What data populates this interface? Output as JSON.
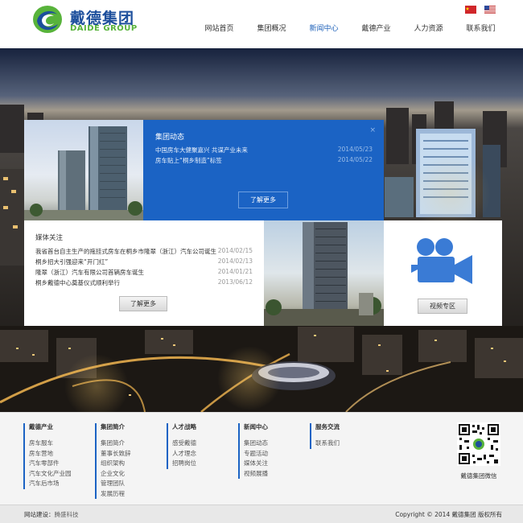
{
  "brand": {
    "name_cn": "戴德集团",
    "name_en": "DAIDE GROUP",
    "colors": {
      "blue": "#1b63c4",
      "green": "#58b33b",
      "dark_blue": "#1d4f9c"
    }
  },
  "nav": {
    "items": [
      {
        "label": "网站首页",
        "active": false
      },
      {
        "label": "集团概况",
        "active": false
      },
      {
        "label": "新闻中心",
        "active": true
      },
      {
        "label": "戴德产业",
        "active": false
      },
      {
        "label": "人力资源",
        "active": false
      },
      {
        "label": "联系我们",
        "active": false
      }
    ]
  },
  "languages": [
    {
      "icon": "china-flag-icon"
    },
    {
      "icon": "usa-flag-icon"
    }
  ],
  "news_panel": {
    "title": "集团动态",
    "close": "×",
    "items": [
      {
        "title": "中国房车大健聚嘉兴 共谋产业未来",
        "date": "2014/05/23"
      },
      {
        "title": "房车贴上“桐乡制造”标签",
        "date": "2014/05/22"
      }
    ],
    "more": "了解更多"
  },
  "media_panel": {
    "title": "媒体关注",
    "items": [
      {
        "title": "我省首台自主生产的拖挂式房车在桐乡市隆翠（浙江）汽车公司诞生",
        "date": "2014/02/15"
      },
      {
        "title": "桐乡招大引强迎来“开门红”",
        "date": "2014/02/13"
      },
      {
        "title": "隆翠（浙江）汽车有限公司首辆房车诞生",
        "date": "2014/01/21"
      },
      {
        "title": "桐乡戴德中心奠基仪式顺利举行",
        "date": "2013/06/12"
      }
    ],
    "more": "了解更多"
  },
  "video_panel": {
    "icon": "video-camera-icon",
    "button": "视频专区"
  },
  "footer": {
    "columns": [
      {
        "title": "戴德产业",
        "links": [
          "房车服车",
          "房车营地",
          "汽车零部件",
          "汽车文化产业园",
          "汽车后市场"
        ]
      },
      {
        "title": "集团简介",
        "links": [
          "集团简介",
          "董事长致辞",
          "组织架构",
          "企业文化",
          "管理团队",
          "发展历程"
        ]
      },
      {
        "title": "人才战略",
        "links": [
          "感受戴德",
          "人才理念",
          "招聘岗位"
        ]
      },
      {
        "title": "新闻中心",
        "links": [
          "集团动态",
          "专题活动",
          "媒体关注",
          "视频展播"
        ]
      },
      {
        "title": "服务交流",
        "links": [
          "联系我们"
        ]
      }
    ],
    "qr_label": "戴德集团微信"
  },
  "bottom_bar": {
    "build_label": "网站建设：",
    "build_link": "腾盛科技",
    "copyright": "Copyright © 2014 戴德集团 版权所有"
  }
}
